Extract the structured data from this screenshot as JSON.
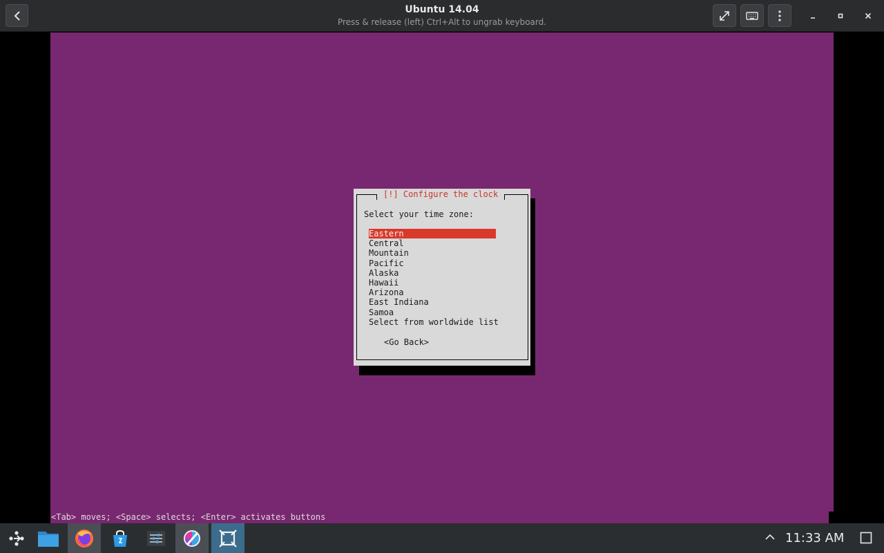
{
  "window": {
    "title": "Ubuntu 14.04",
    "subtitle": "Press & release (left) Ctrl+Alt to ungrab keyboard."
  },
  "dialog": {
    "title": "[!] Configure the clock",
    "prompt": "Select your time zone:",
    "options": [
      "Eastern",
      "Central",
      "Mountain",
      "Pacific",
      "Alaska",
      "Hawaii",
      "Arizona",
      "East Indiana",
      "Samoa",
      "Select from worldwide list"
    ],
    "selected_index": 0,
    "go_back": "<Go Back>"
  },
  "status_line": "<Tab> moves; <Space> selects; <Enter> activates buttons",
  "taskbar": {
    "clock": "11:33 AM",
    "apps": [
      "app-launcher-icon",
      "file-manager-icon",
      "firefox-icon",
      "software-store-icon",
      "system-settings-icon",
      "krita-icon",
      "virtual-machine-icon"
    ]
  },
  "colors": {
    "vm_background": "#782870",
    "selection": "#d8392b",
    "dialog_title": "#c7362a",
    "dialog_background": "#d9d9d9"
  }
}
